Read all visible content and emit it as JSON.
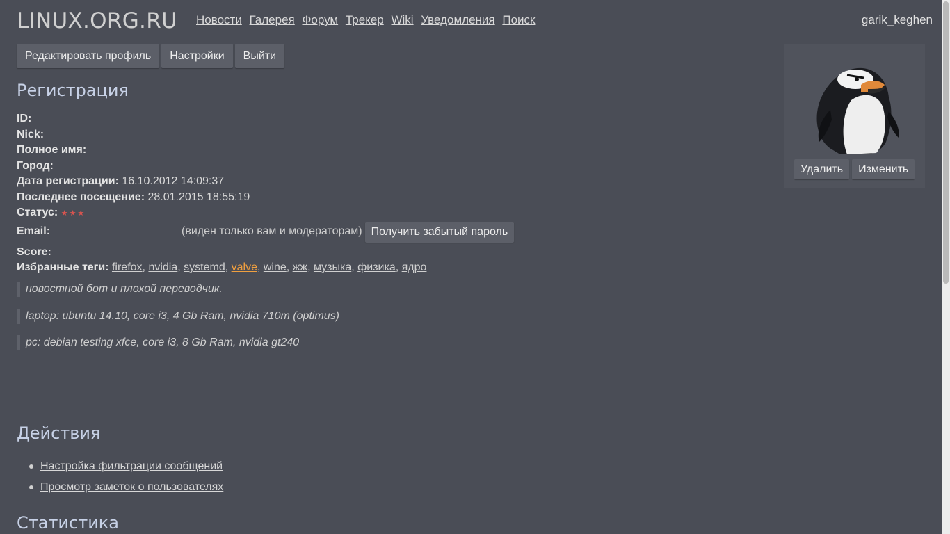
{
  "header": {
    "logo": "LINUX.ORG.RU",
    "nav": [
      "Новости",
      "Галерея",
      "Форум",
      "Трекер",
      "Wiki",
      "Уведомления",
      "Поиск"
    ],
    "username": "garik_keghen"
  },
  "toolbar": {
    "edit_profile": "Редактировать профиль",
    "settings": "Настройки",
    "logout": "Выйти"
  },
  "registration": {
    "title": "Регистрация",
    "id_label": "ID:",
    "nick_label": "Nick:",
    "fullname_label": "Полное имя:",
    "city_label": "Город:",
    "regdate_label": "Дата регистрации:",
    "regdate_value": "16.10.2012 14:09:37",
    "lastvisit_label": "Последнее посещение:",
    "lastvisit_value": "28.01.2015 18:55:19",
    "status_label": "Статус:",
    "status_stars": "★★★",
    "email_label": "Email:",
    "email_note": "(виден только вам и модераторам)",
    "forgot_password": "Получить забытый пароль",
    "score_label": "Score:",
    "tags_label": "Избранные теги:",
    "tags": [
      "firefox",
      "nvidia",
      "systemd",
      "valve",
      "wine",
      "жж",
      "музыка",
      "физика",
      "ядро"
    ]
  },
  "about": [
    "новостной бот и плохой переводчик.",
    "laptop: ubuntu 14.10, core i3, 4 Gb Ram, nvidia 710m (optimus)",
    "pc: debian testing xfce, core i3, 8 Gb Ram, nvidia gt240"
  ],
  "avatar": {
    "delete": "Удалить",
    "change": "Изменить"
  },
  "actions": {
    "title": "Действия",
    "items": [
      "Настройка фильтрации сообщений",
      "Просмотр заметок о пользователях"
    ]
  },
  "stats": {
    "title": "Статистика"
  },
  "colors": {
    "background": "#4a4d56",
    "highlight_tag": "#f0a040",
    "heading": "#c7d1e6",
    "stars": "#d9544f"
  }
}
